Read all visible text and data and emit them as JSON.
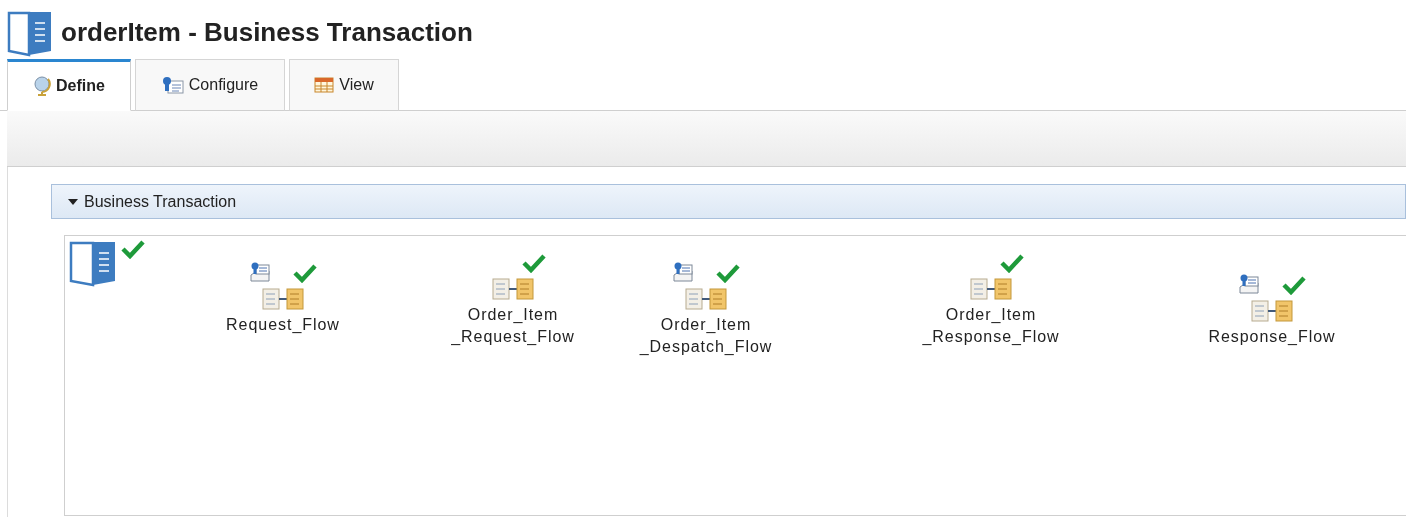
{
  "title": "orderItem - Business Transaction",
  "tabs": [
    {
      "label": "Define",
      "selected": true,
      "kind": "globe"
    },
    {
      "label": "Configure",
      "selected": false,
      "kind": "config"
    },
    {
      "label": "View",
      "selected": false,
      "kind": "table"
    }
  ],
  "section": {
    "label": "Business Transaction",
    "expanded": true
  },
  "root": {
    "valid": true
  },
  "nodes": [
    {
      "lines": [
        "Request_Flow"
      ],
      "configured": true,
      "valid": true
    },
    {
      "lines": [
        "Order_Item",
        "_Request_Flow"
      ],
      "configured": false,
      "valid": true
    },
    {
      "lines": [
        "Order_Item",
        "_Despatch_Flow"
      ],
      "configured": true,
      "valid": true
    },
    {
      "lines": [
        "Order_Item",
        "_Response_Flow"
      ],
      "configured": false,
      "valid": true
    },
    {
      "lines": [
        "Response_Flow"
      ],
      "configured": true,
      "valid": true
    }
  ]
}
